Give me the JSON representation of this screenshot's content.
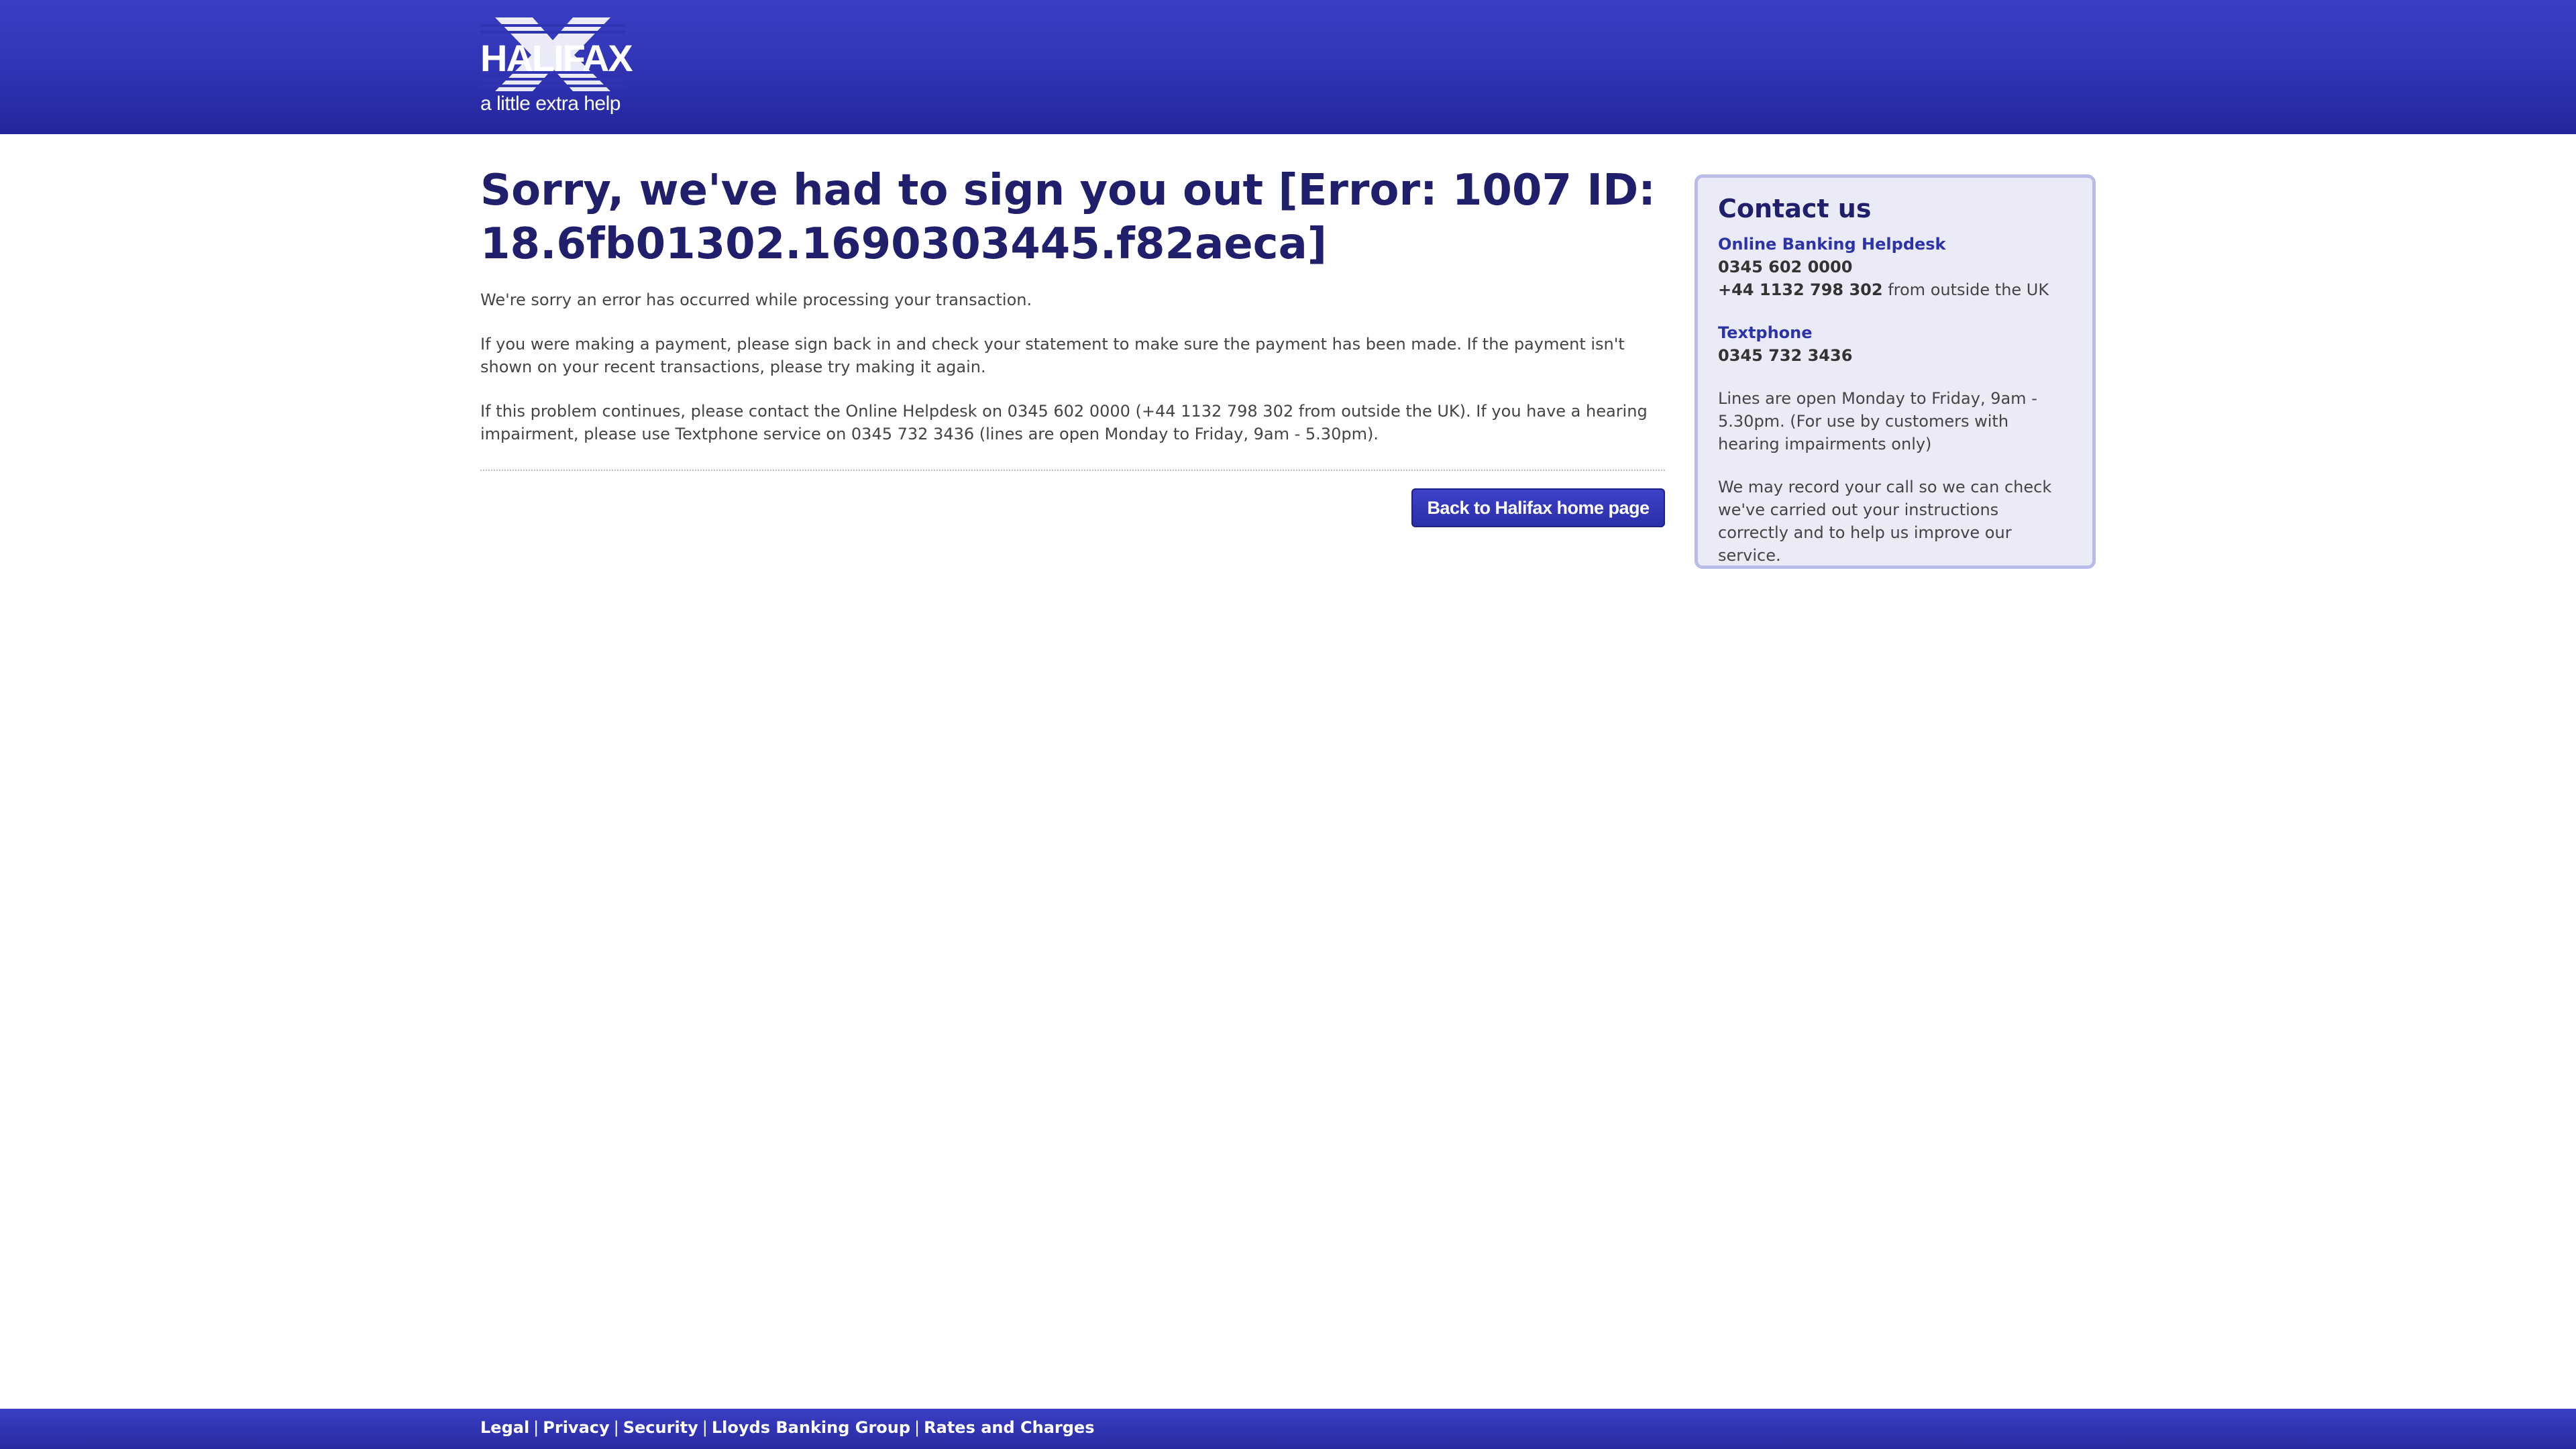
{
  "header": {
    "logo_text": "HALIFAX",
    "logo_tagline": "a little extra help",
    "brand_color": "#3a3ec4"
  },
  "main": {
    "title": "Sorry, we've had to sign you out [Error: 1007 ID: 18.6fb01302.1690303445.f82aeca]",
    "paragraph_1": "We're sorry an error has occurred while processing your transaction.",
    "paragraph_2": "If you were making a payment, please sign back in and check your statement to make sure the payment has been made. If the payment isn't shown on your recent transactions, please try making it again.",
    "paragraph_3": "If this problem continues, please contact the Online Helpdesk on 0345 602 0000 (+44 1132 798 302 from outside the UK). If you have a hearing impairment, please use Textphone service on 0345 732 3436 (lines are open Monday to Friday, 9am - 5.30pm).",
    "home_button_label": "Back to Halifax home page"
  },
  "contact": {
    "title": "Contact us",
    "helpdesk_label": "Online Banking Helpdesk",
    "helpdesk_phone": "0345 602 0000",
    "helpdesk_intl_phone": "+44 1132 798 302",
    "helpdesk_intl_suffix": " from outside the UK",
    "textphone_label": "Textphone",
    "textphone_phone": "0345 732 3436",
    "hours_text": "Lines are open Monday to Friday, 9am - 5.30pm. (For use by customers with hearing impairments only)",
    "record_text": "We may record your call so we can check we've carried out your instructions correctly and to help us improve our service."
  },
  "footer": {
    "links": [
      "Legal",
      "Privacy",
      "Security",
      "Lloyds Banking Group",
      "Rates and Charges"
    ],
    "separator": "|"
  }
}
